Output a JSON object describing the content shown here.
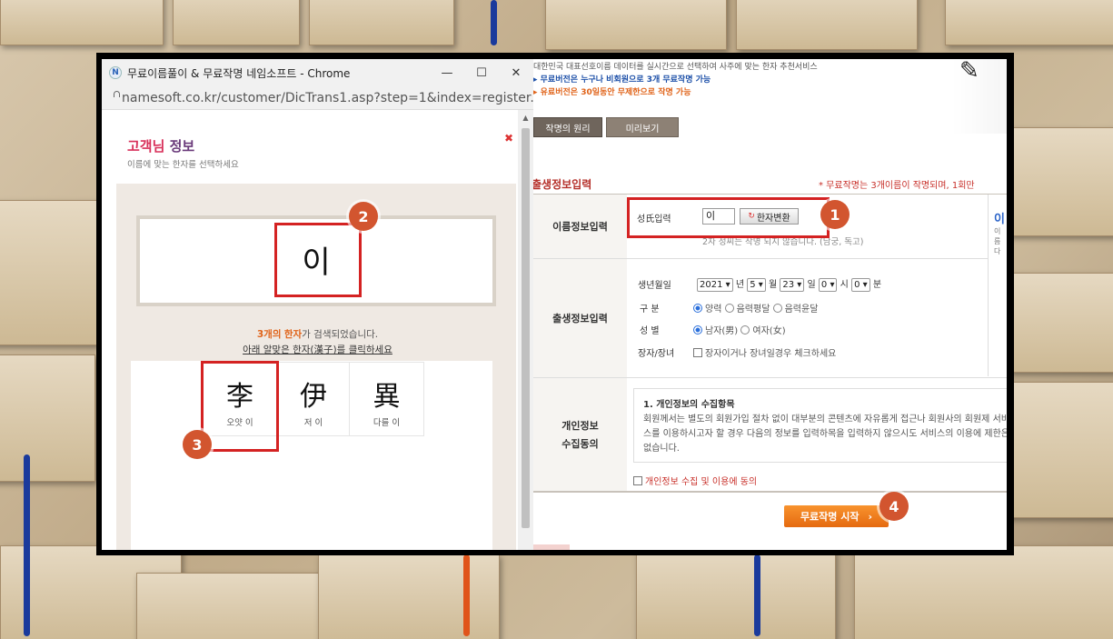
{
  "popup": {
    "window_title": "무료이름풀이 & 무료작명 네임소프트 - Chrome",
    "favicon": "N",
    "url": "namesoft.co.kr/customer/DicTrans1.asp?step=1&index=register...",
    "header_title_part1": "고객님",
    "header_title_part2": " 정보",
    "header_subtitle": "이름에 맞는 한자를 선택하세요",
    "entered_char": "이",
    "result_count": "3개의",
    "result_word": "한자",
    "result_suffix": "가 검색되었습니다.",
    "click_prompt": "아래 알맞은 한자(漢子)를 클릭하세요",
    "hanja": [
      {
        "char": "李",
        "reading": "오얏 이"
      },
      {
        "char": "伊",
        "reading": "저 이"
      },
      {
        "char": "異",
        "reading": "다를 이"
      }
    ]
  },
  "right_page": {
    "intro_line1": "대한민국 대표선호이름 데이터를 실시간으로 선택하여 사주에 맞는 한자 추천서비스",
    "intro_line2": "무료버전은 누구나 비회원으로 3개 무료작명 가능",
    "intro_line3": "유료버전은 30일동안 무제한으로 작명 가능",
    "tab1": "작명의 원리",
    "tab2": "미리보기",
    "section_title": "출생정보입력",
    "notice": "* 무료작명는 3개이름이 작명되며, 1회만",
    "row_name_label": "이름정보입력",
    "surname_label": "성氏입력",
    "surname_value": "이",
    "hanja_button": "한자변환",
    "surname_note": "2자 성씨는 작명 되지 않습니다. (남궁, 독고)",
    "row_birth_label": "출생정보입력",
    "birth_label": "생년월일",
    "year": "2021",
    "year_unit": "년",
    "month": "5",
    "month_unit": "월",
    "day": "23",
    "day_unit": "일",
    "hour": "0",
    "hour_unit": "시",
    "minute": "0",
    "minute_unit": "분",
    "calendar_label": "구 분",
    "calendar_opts": [
      "양력",
      "음력평달",
      "음력윤달"
    ],
    "gender_label": "성 별",
    "gender_opts": [
      "남자(男)",
      "여자(女)"
    ],
    "eldest_label": "장자/장녀",
    "eldest_text": "장자이거나 장녀일경우 체크하세요",
    "side_glyph": "이",
    "side_text1": "이름",
    "side_text2": "다",
    "row_privacy_label_1": "개인정보",
    "row_privacy_label_2": "수집동의",
    "privacy_title": "1. 개인정보의 수집항목",
    "privacy_body": "회원께서는 별도의 회원가입 절차 없이 대부분의 콘텐츠에 자유롭게 접근나 회원사의 회원제 서비스를 이용하시고자 할 경우 다음의 정보를 입력하목을 입력하지 않으시도 서비스의 이용에 제한은 없습니다.",
    "consent_text": "개인정보 수집 및 이용에 동의",
    "start_button": "무료작명 시작",
    "start_arrow": "›"
  },
  "badges": [
    "1",
    "2",
    "3",
    "4"
  ],
  "colors": {
    "accent_red": "#d42222",
    "badge": "#d2552f",
    "orange_button": "#f07a1a"
  }
}
